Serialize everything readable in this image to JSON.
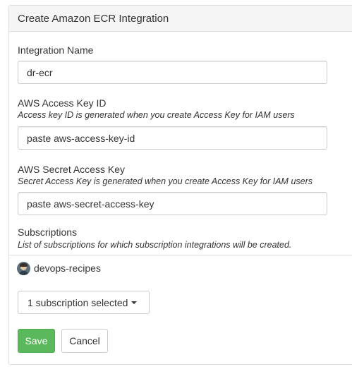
{
  "panel": {
    "title": "Create Amazon ECR Integration"
  },
  "integration_name": {
    "label": "Integration Name",
    "value": "dr-ecr"
  },
  "access_key": {
    "label": "AWS Access Key ID",
    "help": "Access key ID is generated when you create Access Key for IAM users",
    "value": "paste aws-access-key-id"
  },
  "secret_key": {
    "label": "AWS Secret Access Key",
    "help": "Secret Access Key is generated when you create Access Key for IAM users",
    "value": "paste aws-secret-access-key"
  },
  "subscriptions": {
    "label": "Subscriptions",
    "help": "List of subscriptions for which subscription integrations will be created.",
    "items": [
      {
        "name": "devops-recipes",
        "icon": "avatar-icon"
      }
    ],
    "selector_label": "1 subscription selected"
  },
  "actions": {
    "save_label": "Save",
    "cancel_label": "Cancel"
  },
  "colors": {
    "save_button": "#5cb85c",
    "heading_bg": "#f5f5f5",
    "border": "#dddddd"
  }
}
